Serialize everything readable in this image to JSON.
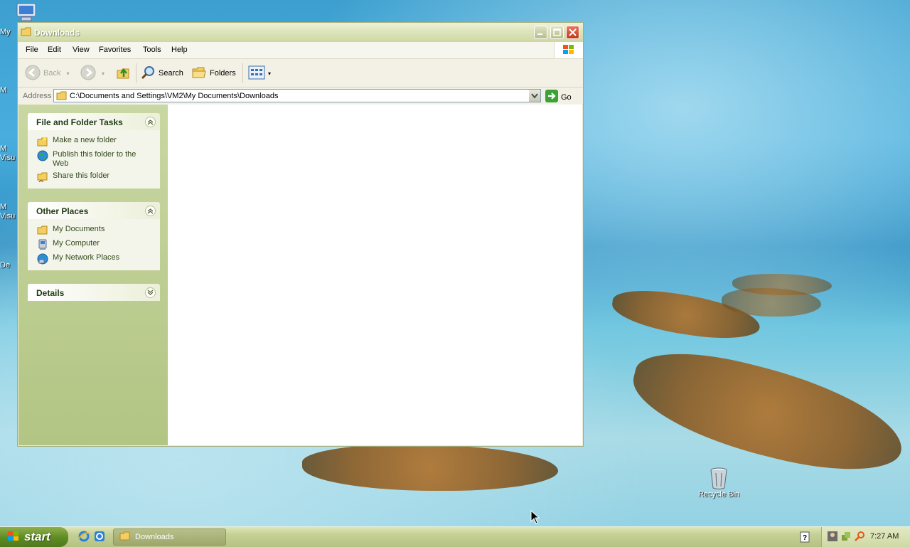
{
  "desktop": {
    "recycle_bin_label": "Recycle Bin",
    "left_clipped_labels": [
      "My",
      "M",
      "M",
      "Visu",
      "M",
      "Visu",
      "De"
    ]
  },
  "window": {
    "title": "Downloads",
    "menu": [
      "File",
      "Edit",
      "View",
      "Favorites",
      "Tools",
      "Help"
    ],
    "toolbar": {
      "back_label": "Back",
      "search_label": "Search",
      "folders_label": "Folders"
    },
    "address": {
      "label": "Address",
      "value": "C:\\Documents and Settings\\VM2\\My Documents\\Downloads",
      "go_label": "Go"
    },
    "sidebar": {
      "file_folder_tasks": {
        "title": "File and Folder Tasks",
        "items": [
          "Make a new folder",
          "Publish this folder to the Web",
          "Share this folder"
        ]
      },
      "other_places": {
        "title": "Other Places",
        "items": [
          "My Documents",
          "My Computer",
          "My Network Places"
        ]
      },
      "details": {
        "title": "Details"
      }
    }
  },
  "taskbar": {
    "start_label": "start",
    "task_button_label": "Downloads",
    "clock": "7:27 AM"
  },
  "colors": {
    "title_bar": "#dfe6bd",
    "close_button": "#c13a1c",
    "sidebar": "#c9d7a2",
    "start_button": "#5c8a23"
  }
}
